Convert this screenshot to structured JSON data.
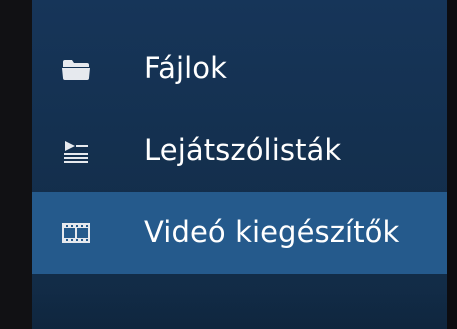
{
  "menu": {
    "items": [
      {
        "label": "Fájlok",
        "icon": "folder-icon",
        "selected": false
      },
      {
        "label": "Lejátszólisták",
        "icon": "playlist-icon",
        "selected": false
      },
      {
        "label": "Videó kiegészítők",
        "icon": "film-icon",
        "selected": true
      }
    ]
  },
  "colors": {
    "panel_background": "#163559",
    "selected_background": "#255a8c",
    "text": "#ffffff",
    "icon": "#e6e9ee",
    "edge": "#111114"
  }
}
